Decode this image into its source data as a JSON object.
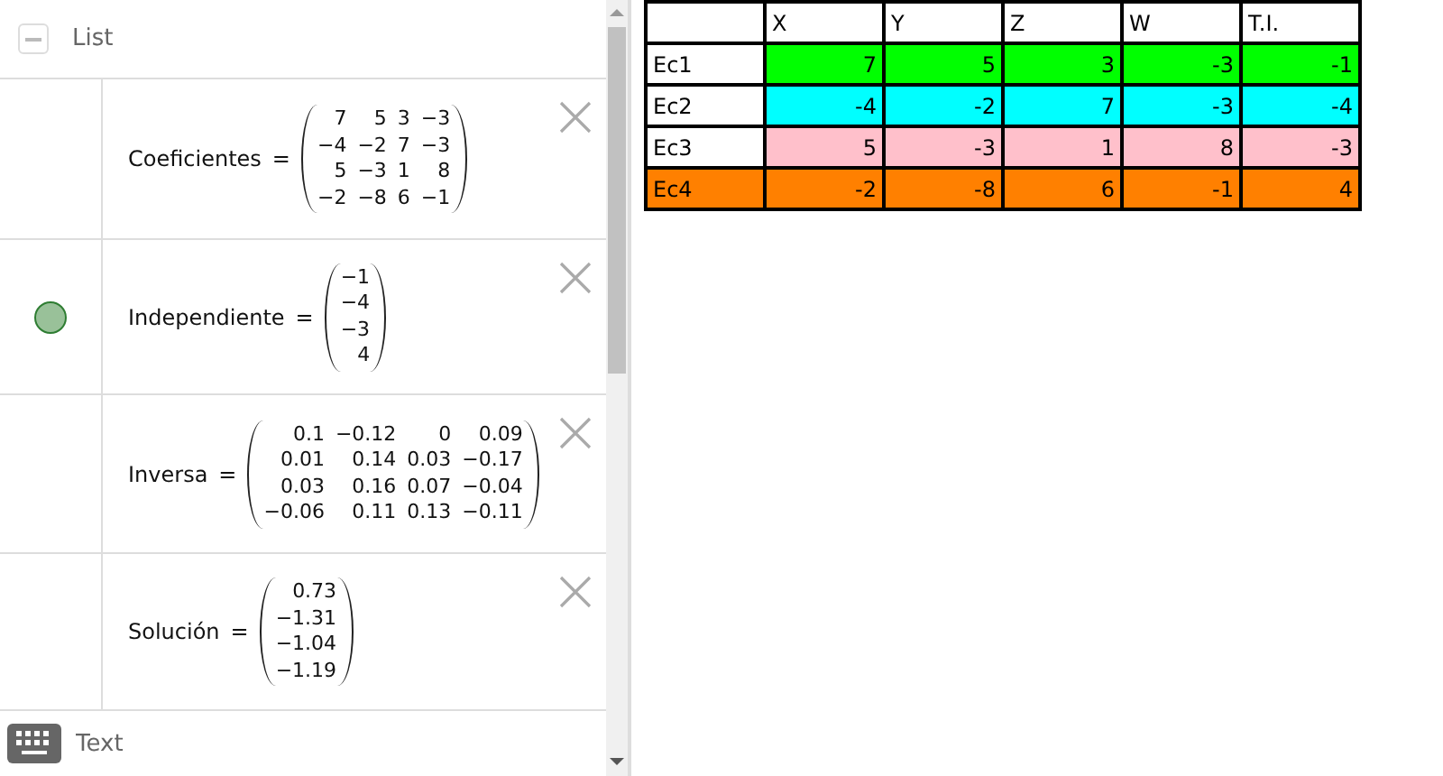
{
  "algebra_view": {
    "header": {
      "label": "List",
      "collapsed": false
    },
    "items": [
      {
        "name": "Coeficientes",
        "relation": "=",
        "shown": false,
        "matrix": [
          [
            "7",
            "5",
            "3",
            "−3"
          ],
          [
            "−4",
            "−2",
            "7",
            "−3"
          ],
          [
            "5",
            "−3",
            "1",
            "8"
          ],
          [
            "−2",
            "−8",
            "6",
            "−1"
          ]
        ]
      },
      {
        "name": "Independiente",
        "relation": "=",
        "shown": true,
        "matrix": [
          [
            "−1"
          ],
          [
            "−4"
          ],
          [
            "−3"
          ],
          [
            "4"
          ]
        ]
      },
      {
        "name": "Inversa",
        "relation": "=",
        "shown": false,
        "matrix": [
          [
            "0.1",
            "−0.12",
            "0",
            "0.09"
          ],
          [
            "0.01",
            "0.14",
            "0.03",
            "−0.17"
          ],
          [
            "0.03",
            "0.16",
            "0.07",
            "−0.04"
          ],
          [
            "−0.06",
            "0.11",
            "0.13",
            "−0.11"
          ]
        ]
      },
      {
        "name": "Solución",
        "relation": "=",
        "shown": false,
        "matrix": [
          [
            "0.73"
          ],
          [
            "−1.31"
          ],
          [
            "−1.04"
          ],
          [
            "−1.19"
          ]
        ]
      }
    ],
    "input": {
      "placeholder": "Text"
    }
  },
  "table": {
    "columns": [
      "X",
      "Y",
      "Z",
      "W",
      "T.I."
    ],
    "rows": [
      {
        "label": "Ec1",
        "label_filled": false,
        "color": "#00ff00",
        "values": [
          "7",
          "5",
          "3",
          "-3",
          "-1"
        ]
      },
      {
        "label": "Ec2",
        "label_filled": false,
        "color": "#00ffff",
        "values": [
          "-4",
          "-2",
          "7",
          "-3",
          "-4"
        ]
      },
      {
        "label": "Ec3",
        "label_filled": false,
        "color": "#ffc0cb",
        "values": [
          "5",
          "-3",
          "1",
          "8",
          "-3"
        ]
      },
      {
        "label": "Ec4",
        "label_filled": true,
        "color": "#ff8000",
        "values": [
          "-2",
          "-8",
          "6",
          "-1",
          "4"
        ]
      }
    ]
  }
}
